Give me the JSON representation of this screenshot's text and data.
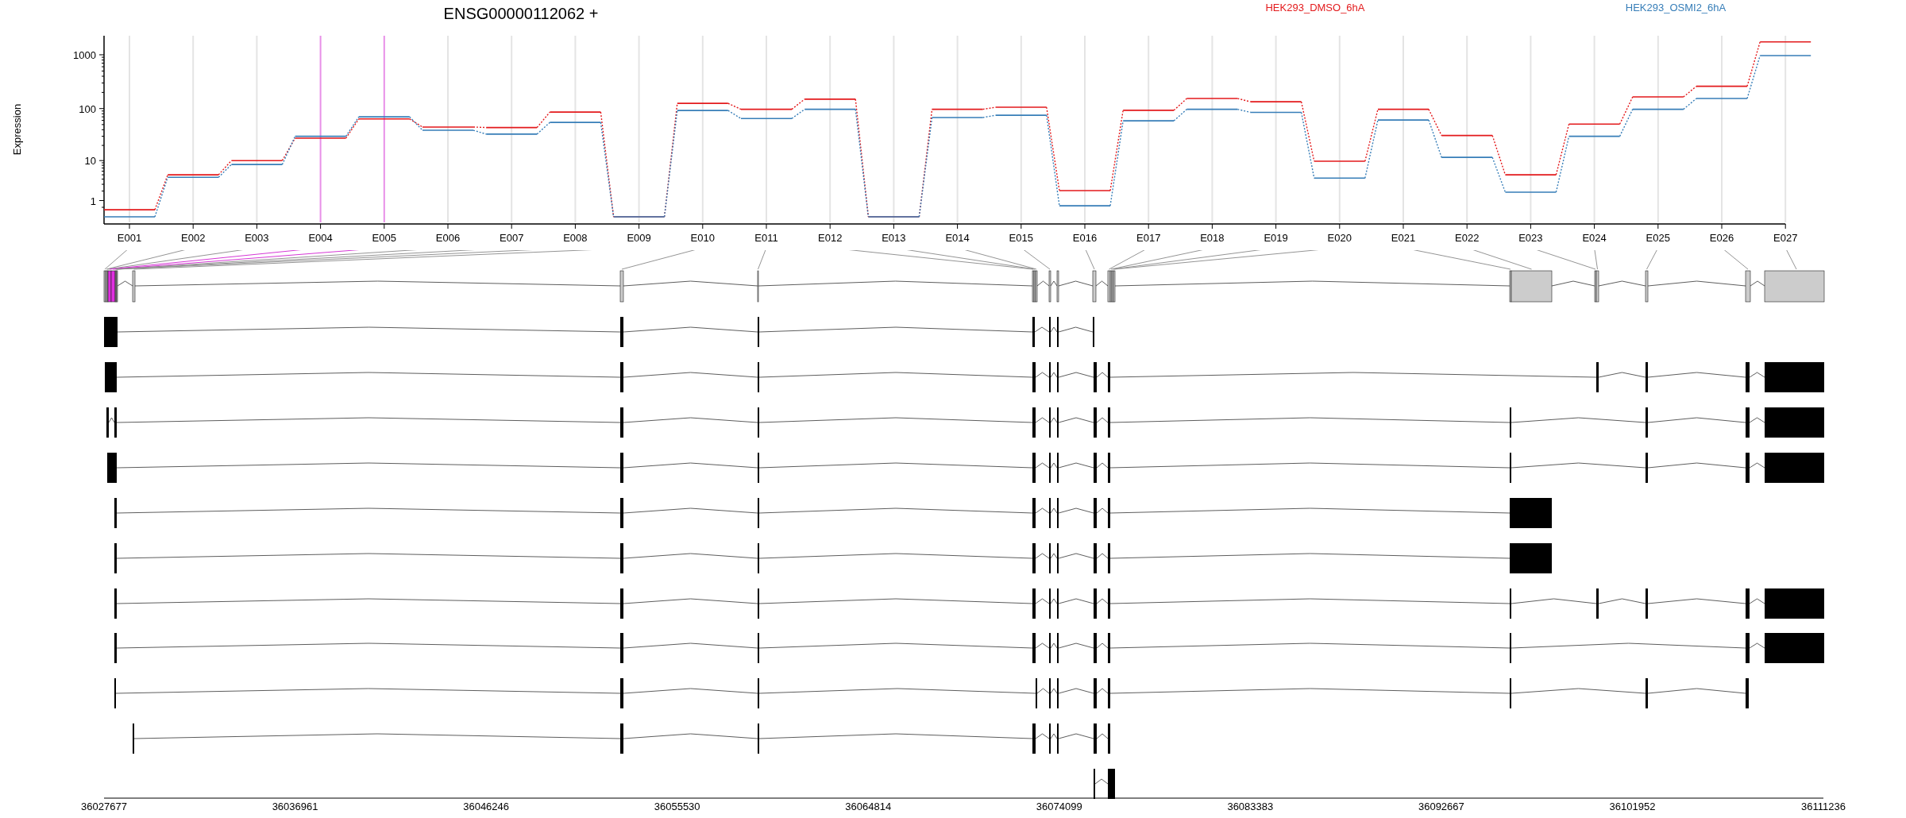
{
  "title": "ENSG00000112062 +",
  "legend": [
    {
      "label": "HEK293_DMSO_6hA",
      "color": "#e31a1c"
    },
    {
      "label": "HEK293_OSMI2_6hA",
      "color": "#377eb8"
    }
  ],
  "expression_plot": {
    "ylabel": "Expression",
    "y_tick_labels": [
      "1000",
      "100",
      "10",
      "1"
    ],
    "exon_labels": [
      "E001",
      "E002",
      "E003",
      "E004",
      "E005",
      "E006",
      "E007",
      "E008",
      "E009",
      "E010",
      "E011",
      "E012",
      "E013",
      "E014",
      "E015",
      "E016",
      "E017",
      "E018",
      "E019",
      "E020",
      "E021",
      "E022",
      "E023",
      "E024",
      "E025",
      "E026",
      "E027"
    ]
  },
  "exons": [
    {
      "highlighted": false
    },
    {
      "highlighted": false
    },
    {
      "highlighted": false
    },
    {
      "highlighted": true
    },
    {
      "highlighted": true
    },
    {
      "highlighted": false
    },
    {
      "highlighted": false
    },
    {
      "highlighted": false
    },
    {
      "highlighted": false
    },
    {
      "highlighted": false
    },
    {
      "highlighted": false
    },
    {
      "highlighted": false
    },
    {
      "highlighted": false
    },
    {
      "highlighted": false
    },
    {
      "highlighted": false
    },
    {
      "highlighted": false
    },
    {
      "highlighted": false
    },
    {
      "highlighted": false
    },
    {
      "highlighted": false
    },
    {
      "highlighted": false
    },
    {
      "highlighted": false
    },
    {
      "highlighted": false
    },
    {
      "highlighted": false
    },
    {
      "highlighted": false
    },
    {
      "highlighted": false
    },
    {
      "highlighted": false
    },
    {
      "highlighted": false
    }
  ],
  "genome_axis": {
    "labels": [
      "36027677",
      "36036961",
      "36046246",
      "36055530",
      "36064814",
      "36074099",
      "36083383",
      "36092667",
      "36101952",
      "36111236"
    ]
  }
}
